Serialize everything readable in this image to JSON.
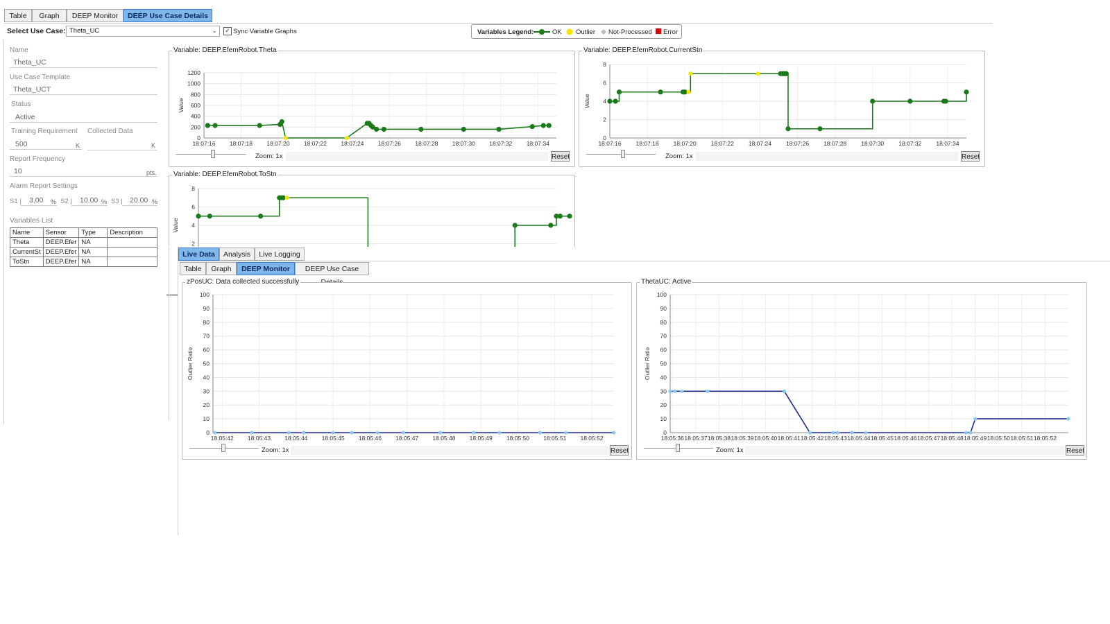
{
  "top_tabs": [
    "Table",
    "Graph",
    "DEEP Monitor",
    "DEEP Use Case Details"
  ],
  "select_use_case": {
    "label": "Select Use Case:",
    "value": "Theta_UC"
  },
  "sync": {
    "label": "Sync Variable Graphs",
    "checked": true
  },
  "legend": {
    "title": "Variables Legend:",
    "items": [
      {
        "label": "OK",
        "color": "#1a7a1a"
      },
      {
        "label": "Outlier",
        "color": "#f2e600"
      },
      {
        "label": "Not-Processed",
        "color": "#bbbbbb"
      },
      {
        "label": "Error",
        "color": "#e00000"
      }
    ]
  },
  "details": {
    "name_label": "Name",
    "name_value": "Theta_UC",
    "template_label": "Use Case Template",
    "template_value": "Theta_UCT",
    "status_label": "Status",
    "status_value": "Active",
    "training_label": "Training Requirement",
    "collected_label": "Collected Data",
    "training_value": "500",
    "training_unit": "K",
    "collected_unit": "K",
    "report_freq_label": "Report Frequency",
    "report_freq_value": "10",
    "report_freq_unit": "pts.",
    "alarm_label": "Alarm Report Settings",
    "s1_label": "S1 |",
    "s1_value": "3.00",
    "s1_unit": "%",
    "s2_label": "S2 |",
    "s2_value": "10.00",
    "s2_unit": "%",
    "s3_label": "S3 |",
    "s3_value": "20.00",
    "s3_unit": "%",
    "vars_label": "Variables List",
    "vars_headers": [
      "Name",
      "Sensor",
      "Type",
      "Description"
    ],
    "vars_rows": [
      [
        "Theta",
        "DEEP.Efer",
        "NA",
        ""
      ],
      [
        "CurrentSt",
        "DEEP.Efer",
        "NA",
        ""
      ],
      [
        "ToStn",
        "DEEP.Efer",
        "NA",
        ""
      ]
    ]
  },
  "zoom_label": "Zoom: 1x",
  "reset_label": "Reset",
  "bottom_tabs": [
    "Live Data",
    "Analysis",
    "Live Logging"
  ],
  "inner_tabs": [
    "Table",
    "Graph",
    "DEEP Monitor",
    "DEEP Use Case Details"
  ],
  "chart_data": [
    {
      "type": "line",
      "title": "Variable: DEEP.EfemRobot.Theta",
      "ylabel": "Value",
      "yticks": [
        0,
        200,
        400,
        600,
        800,
        1000,
        1200
      ],
      "ylim": [
        0,
        1200
      ],
      "xticks": [
        "18:07:16",
        "18:07:18",
        "18:07:20",
        "18:07:22",
        "18:07:24",
        "18:07:26",
        "18:07:28",
        "18:07:30",
        "18:07:32",
        "18:07:34"
      ],
      "xlim": [
        16,
        35
      ],
      "step": false,
      "x": [
        16.2,
        16.6,
        19.0,
        20.1,
        20.2,
        20.4,
        23.7,
        24.8,
        24.9,
        25.0,
        25.1,
        25.3,
        25.7,
        27.7,
        30.0,
        31.9,
        33.7,
        34.3,
        34.6
      ],
      "y": [
        230,
        230,
        230,
        250,
        300,
        0,
        0,
        270,
        270,
        230,
        200,
        160,
        160,
        160,
        160,
        160,
        210,
        230,
        230
      ],
      "status": [
        "ok",
        "ok",
        "ok",
        "ok",
        "ok",
        "outlier",
        "outlier",
        "ok",
        "ok",
        "ok",
        "ok",
        "ok",
        "ok",
        "ok",
        "ok",
        "ok",
        "ok",
        "ok",
        "ok"
      ]
    },
    {
      "type": "line",
      "title": "Variable: DEEP.EfemRobot.CurrentStn",
      "ylabel": "Value",
      "yticks": [
        0,
        2,
        4,
        6,
        8
      ],
      "ylim": [
        0,
        8
      ],
      "xticks": [
        "18:07:16",
        "18:07:18",
        "18:07:20",
        "18:07:22",
        "18:07:24",
        "18:07:26",
        "18:07:28",
        "18:07:30",
        "18:07:32",
        "18:07:34"
      ],
      "xlim": [
        16,
        35
      ],
      "step": true,
      "x": [
        16,
        16.3,
        16.5,
        18.7,
        19.9,
        20.0,
        20.2,
        20.3,
        23.9,
        25.1,
        25.2,
        25.3,
        25.4,
        25.5,
        27.2,
        30.0,
        32.0,
        33.8,
        33.9,
        35.0
      ],
      "y": [
        4,
        4,
        5,
        5,
        5,
        5,
        5,
        7,
        7,
        7,
        7,
        7,
        7,
        1,
        1,
        4,
        4,
        4,
        4,
        5
      ],
      "status": [
        "ok",
        "ok",
        "ok",
        "ok",
        "ok",
        "ok",
        "outlier",
        "outlier",
        "outlier",
        "ok",
        "ok",
        "ok",
        "ok",
        "ok",
        "ok",
        "ok",
        "ok",
        "ok",
        "ok",
        "ok"
      ]
    },
    {
      "type": "line",
      "title": "Variable: DEEP.EfemRobot.ToStn",
      "ylabel": "Value",
      "yticks": [
        2,
        4,
        6,
        8
      ],
      "ylim": [
        0,
        8
      ],
      "xlim": [
        16,
        35
      ],
      "step": true,
      "x": [
        16,
        16.6,
        19.3,
        20.3,
        20.4,
        20.5,
        20.7,
        25.0,
        30.5,
        32.8,
        34.7,
        35.0,
        35.2,
        35.7
      ],
      "y": [
        5,
        5,
        5,
        7,
        7,
        7,
        7,
        0,
        0,
        4,
        4,
        5,
        5,
        5
      ],
      "status": [
        "ok",
        "ok",
        "ok",
        "ok",
        "ok",
        "ok",
        "outlier",
        "ok",
        "ok",
        "ok",
        "ok",
        "ok",
        "ok",
        "ok"
      ]
    },
    {
      "type": "line",
      "title": "zPosUC: Data collected successfully",
      "ylabel": "Outlier Ratio",
      "yticks": [
        0,
        10,
        20,
        30,
        40,
        50,
        60,
        70,
        80,
        90,
        100
      ],
      "ylim": [
        0,
        100
      ],
      "xticks": [
        "18:05:42",
        "18:05:43",
        "18:05:44",
        "18:05:45",
        "18:05:46",
        "18:05:47",
        "18:05:48",
        "18:05:49",
        "18:05:50",
        "18:05:51",
        "18:05:52"
      ],
      "xlim": [
        41.75,
        52.6
      ],
      "x": [
        41.8,
        42.8,
        43.8,
        44.2,
        45.0,
        45.5,
        46.2,
        46.9,
        47.9,
        48.8,
        49.5,
        50.6,
        51.3,
        52.6
      ],
      "y": [
        0,
        0,
        0,
        0,
        0,
        0,
        0,
        0,
        0,
        0,
        0,
        0,
        0,
        0
      ]
    },
    {
      "type": "line",
      "title": "ThetaUC: Active",
      "ylabel": "Outlier Ratio",
      "yticks": [
        0,
        10,
        20,
        30,
        40,
        50,
        60,
        70,
        80,
        90,
        100
      ],
      "ylim": [
        0,
        100
      ],
      "xticks": [
        "18:05:36",
        "18:05:37",
        "18:05:38",
        "18:05:39",
        "18:05:40",
        "18:05:41",
        "18:05:42",
        "18:05:43",
        "18:05:44",
        "18:05:45",
        "18:05:46",
        "18:05:47",
        "18:05:48",
        "18:05:49",
        "18:05:50",
        "18:05:51",
        "18:05:52"
      ],
      "xlim": [
        35.9,
        53.0
      ],
      "x": [
        35.9,
        36.1,
        36.4,
        37.5,
        40.8,
        41.9,
        42.9,
        43.1,
        43.7,
        44.3,
        48.6,
        48.8,
        49.0,
        53.0
      ],
      "y": [
        30,
        30,
        30,
        30,
        30,
        0,
        0,
        0,
        0,
        0,
        0,
        0,
        10,
        10
      ]
    }
  ]
}
